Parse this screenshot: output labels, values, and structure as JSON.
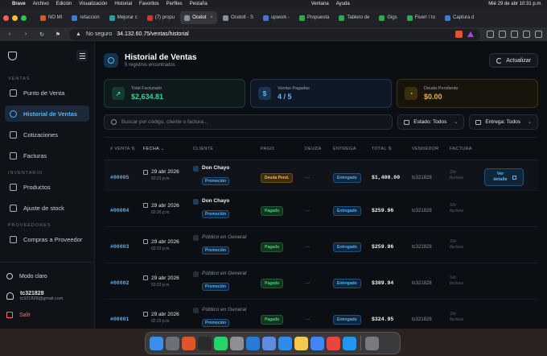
{
  "menubar": {
    "app": "Brave",
    "items": [
      "Archivo",
      "Edición",
      "Visualización",
      "Historial",
      "Favoritos",
      "Perfiles",
      "Pestaña"
    ],
    "right": [
      "Ventana",
      "Ayuda"
    ],
    "clock": "Mié 29 de abr 10:31 p.m."
  },
  "tabs": [
    {
      "label": "NO MI",
      "color": "#e0532c"
    },
    {
      "label": "refaccion",
      "color": "#3c7bd8"
    },
    {
      "label": "Mejorar c",
      "color": "#2aa198"
    },
    {
      "label": "(7) propu",
      "color": "#e02d2d"
    },
    {
      "label": "Ocelot",
      "color": "#8a8f98",
      "active": true
    },
    {
      "label": "Ocelotl - S",
      "color": "#8a8f98"
    },
    {
      "label": "upwork -",
      "color": "#4a6fd8"
    },
    {
      "label": "Propuesta",
      "color": "#2fa84f"
    },
    {
      "label": "Tablero de",
      "color": "#2fa84f"
    },
    {
      "label": "Gigs",
      "color": "#2fa84f"
    },
    {
      "label": "Fiverr / to",
      "color": "#2fa84f"
    },
    {
      "label": "Captura d",
      "color": "#3c7bd8"
    }
  ],
  "address": {
    "security": "No seguro",
    "url": "34.132.60.75/ventas/historial"
  },
  "sidebar": {
    "sections": [
      {
        "title": "VENTAS",
        "items": [
          {
            "label": "Punto de Venta",
            "icon": "monitor-icon"
          },
          {
            "label": "Historial de Ventas",
            "icon": "history-icon",
            "active": true
          },
          {
            "label": "Cotizaciones",
            "icon": "document-icon"
          },
          {
            "label": "Facturas",
            "icon": "invoice-icon"
          }
        ]
      },
      {
        "title": "INVENTARIO",
        "items": [
          {
            "label": "Productos",
            "icon": "box-icon"
          },
          {
            "label": "Ajuste de stock",
            "icon": "clipboard-icon"
          }
        ]
      },
      {
        "title": "PROVEEDORES",
        "items": [
          {
            "label": "Compras a Proveedor",
            "icon": "truck-icon"
          }
        ]
      }
    ],
    "theme_toggle": "Modo claro",
    "user_name": "tc321828",
    "user_email": "tc321828@gmail.com",
    "logout": "Salir"
  },
  "page": {
    "title": "Historial de Ventas",
    "subtitle": "5 registros encontrados",
    "refresh": "Actualizar"
  },
  "stats": [
    {
      "label": "Total Facturado",
      "value": "$2,634.81",
      "icon": "trend-up-icon",
      "glyph": "↗",
      "tone": "green"
    },
    {
      "label": "Ventas Pagadas",
      "value": "4 / 5",
      "icon": "dollar-icon",
      "glyph": "$",
      "tone": "blue"
    },
    {
      "label": "Deuda Pendiente",
      "value": "$0.00",
      "icon": "clock-icon",
      "glyph": "◔",
      "tone": "amber"
    }
  ],
  "filters": {
    "search_placeholder": "Buscar por código, cliente o factura...",
    "estado": "Estado: Todos",
    "entrega": "Entrega: Todos"
  },
  "table": {
    "headers": {
      "num": "# VENTA",
      "fecha": "FECHA",
      "cliente": "CLIENTE",
      "pago": "PAGO",
      "deuda": "DEUDA",
      "entrega": "ENTREGA",
      "total": "TOTAL",
      "vendedor": "VENDEDOR",
      "factura": "FACTURA"
    },
    "rows": [
      {
        "num": "#00005",
        "date": "29 abr 2026",
        "time": "02:21 p.m.",
        "client": "Don Chayo",
        "named": true,
        "promo": "Promoción",
        "pago": "Deuda Pend.",
        "pago_tone": "amber",
        "deuda": "—",
        "entrega": "Entregado",
        "total": "$1,400.00",
        "vendedor": "tc321828",
        "factura": "Sin factura",
        "action": "Ver detalle"
      },
      {
        "num": "#00004",
        "date": "29 abr 2026",
        "time": "02:26 p.m.",
        "client": "Don Chayo",
        "named": true,
        "promo": "Promoción",
        "pago": "Pagado",
        "pago_tone": "green",
        "deuda": "—",
        "entrega": "Entregado",
        "total": "$259.96",
        "vendedor": "tc321828",
        "factura": "Sin factura"
      },
      {
        "num": "#00003",
        "date": "29 abr 2026",
        "time": "02:22 p.m.",
        "client": "Público en General",
        "named": false,
        "promo": "Promoción",
        "pago": "Pagado",
        "pago_tone": "green",
        "deuda": "—",
        "entrega": "Entregado",
        "total": "$259.96",
        "vendedor": "tc321828",
        "factura": "Sin factura"
      },
      {
        "num": "#00002",
        "date": "29 abr 2026",
        "time": "02:22 p.m.",
        "client": "Público en General",
        "named": false,
        "promo": "Promoción",
        "pago": "Pagado",
        "pago_tone": "green",
        "deuda": "—",
        "entrega": "Entregado",
        "total": "$389.94",
        "vendedor": "tc321828",
        "factura": "Sin factura"
      },
      {
        "num": "#00001",
        "date": "29 abr 2026",
        "time": "02:22 p.m.",
        "client": "Público en General",
        "named": false,
        "promo": "Promoción",
        "pago": "Pagado",
        "pago_tone": "green",
        "deuda": "—",
        "entrega": "Entregado",
        "total": "$324.95",
        "vendedor": "tc321828",
        "factura": "Sin factura"
      }
    ]
  },
  "dock_apps": [
    {
      "name": "finder-icon",
      "color": "#3d8ee8"
    },
    {
      "name": "launchpad-icon",
      "color": "#6b6f78"
    },
    {
      "name": "brave-icon",
      "color": "#e0532c"
    },
    {
      "name": "terminal-icon",
      "color": "#2a2a2a"
    },
    {
      "name": "whatsapp-icon",
      "color": "#25d366"
    },
    {
      "name": "settings-icon",
      "color": "#8e8e93"
    },
    {
      "name": "vscode-icon",
      "color": "#2a7ad4"
    },
    {
      "name": "preview-icon",
      "color": "#5b8de0"
    },
    {
      "name": "safari-icon",
      "color": "#2f8be6"
    },
    {
      "name": "notes-icon",
      "color": "#f2c94c"
    },
    {
      "name": "android-studio-icon",
      "color": "#4285f4"
    },
    {
      "name": "chrome-icon",
      "color": "#e8453c"
    },
    {
      "name": "docker-icon",
      "color": "#2496ed"
    },
    {
      "name": "trash-icon",
      "color": "#7a7a7e"
    }
  ]
}
